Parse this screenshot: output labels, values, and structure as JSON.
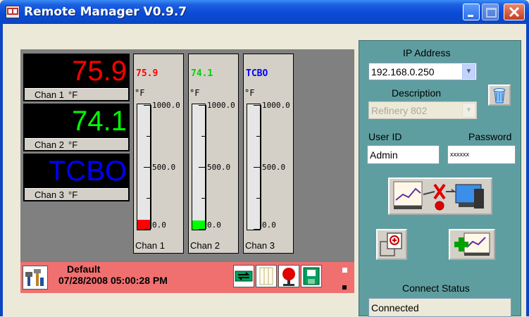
{
  "window": {
    "title": "Remote Manager V0.9.7"
  },
  "channels": [
    {
      "value": "75.9",
      "name": "Chan 1",
      "unit": "°F",
      "color": "#ff0000"
    },
    {
      "value": "74.1",
      "name": "Chan 2",
      "unit": "°F",
      "color": "#00ff00"
    },
    {
      "value": "TCBO",
      "name": "Chan 3",
      "unit": "°F",
      "color": "#0000ff"
    }
  ],
  "bars": [
    {
      "value": "75.9",
      "unit": "°F",
      "name": "Chan 1",
      "color": "#ff0000",
      "text_color": "#ff0000",
      "level": 0.076,
      "max": "1000.0",
      "mid": "500.0",
      "min": "0.0"
    },
    {
      "value": "74.1",
      "unit": "°F",
      "name": "Chan 2",
      "color": "#00ff00",
      "text_color": "#00d000",
      "level": 0.074,
      "max": "1000.0",
      "mid": "500.0",
      "min": "0.0"
    },
    {
      "value": "TCBO",
      "unit": "°F",
      "name": "Chan 3",
      "color": "#0000ff",
      "text_color": "#0000ff",
      "level": 0,
      "max": "1000.0",
      "mid": "500.0",
      "min": "0.0"
    }
  ],
  "footer": {
    "profile": "Default",
    "datetime": "07/28/2008 05:00:28 PM"
  },
  "connection": {
    "ip_label": "IP Address",
    "ip_value": "192.168.0.250",
    "description_label": "Description",
    "description_value": "Refinery 802",
    "user_label": "User ID",
    "user_value": "Admin",
    "password_label": "Password",
    "password_value": "xxxxxx",
    "status_label": "Connect Status",
    "status_value": "Connected"
  }
}
